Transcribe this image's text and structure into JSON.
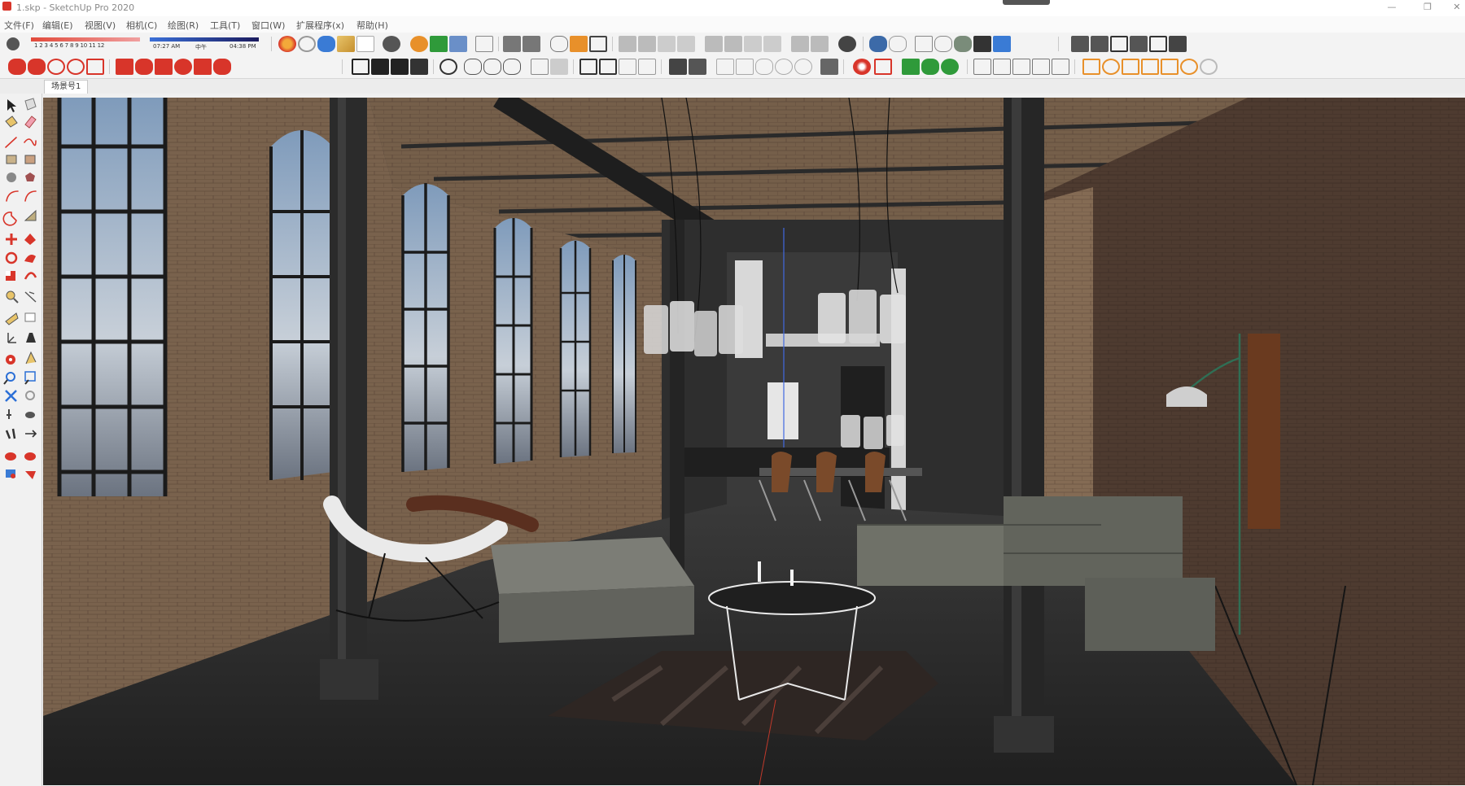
{
  "window": {
    "title": "1.skp - SketchUp Pro 2020"
  },
  "menu": {
    "items": [
      "文件(F)",
      "编辑(E)",
      "视图(V)",
      "相机(C)",
      "绘图(R)",
      "工具(T)",
      "窗口(W)",
      "扩展程序(x)",
      "帮助(H)"
    ]
  },
  "shadow_toolbar": {
    "month_ticks": "1 2 3 4 5 6 7 8 9 10 11 12",
    "time_start": "07:27 AM",
    "time_mid": "中午",
    "time_end": "04:38 PM"
  },
  "scene_tabs": [
    "场景号1"
  ],
  "colors": {
    "accent_red": "#d8352a",
    "accent_blue": "#2b6fd6",
    "accent_green": "#2f9a3a",
    "accent_orange": "#e8902a"
  }
}
